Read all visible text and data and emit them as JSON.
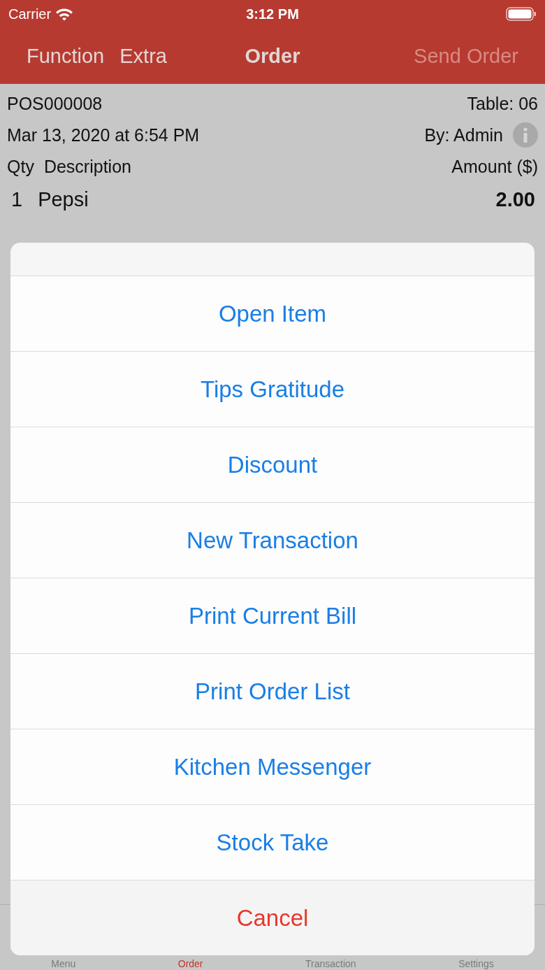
{
  "status_bar": {
    "carrier": "Carrier",
    "time": "3:12 PM"
  },
  "nav_bar": {
    "left_buttons": [
      "Function",
      "Extra"
    ],
    "title": "Order",
    "right_button": {
      "label": "Send Order",
      "disabled": true
    }
  },
  "order": {
    "number": "POS000008",
    "table": "Table: 06",
    "date": "Mar 13, 2020 at 6:54 PM",
    "by": "By: Admin",
    "columns": {
      "qty": "Qty",
      "description": "Description",
      "amount": "Amount ($)"
    },
    "items": [
      {
        "qty": "1",
        "name": "Pepsi",
        "amount": "2.00"
      }
    ]
  },
  "action_sheet": {
    "actions": [
      {
        "label": "Open Item",
        "kind": "default"
      },
      {
        "label": "Tips Gratitude",
        "kind": "default"
      },
      {
        "label": "Discount",
        "kind": "default"
      },
      {
        "label": "New Transaction",
        "kind": "default"
      },
      {
        "label": "Print Current Bill",
        "kind": "default"
      },
      {
        "label": "Print Order List",
        "kind": "default"
      },
      {
        "label": "Kitchen Messenger",
        "kind": "default"
      },
      {
        "label": "Stock Take",
        "kind": "default"
      },
      {
        "label": "Cancel",
        "kind": "cancel"
      }
    ]
  },
  "tab_bar": [
    {
      "label": "Menu",
      "selected": false
    },
    {
      "label": "Order",
      "selected": true
    },
    {
      "label": "Transaction",
      "selected": false
    },
    {
      "label": "Settings",
      "selected": false
    }
  ]
}
